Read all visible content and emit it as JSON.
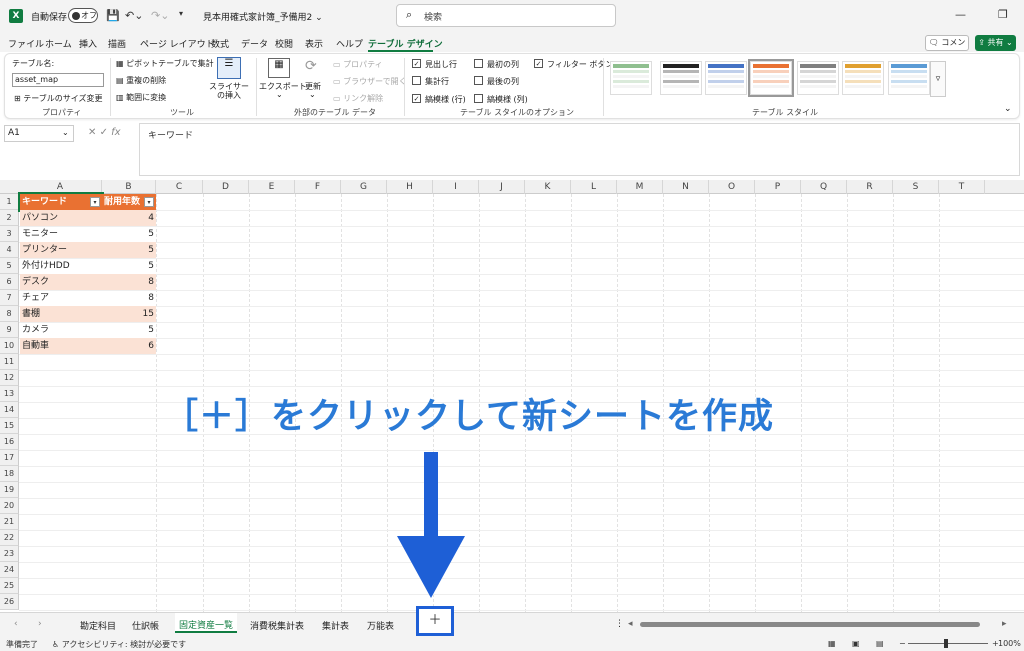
{
  "titlebar": {
    "logo": "X",
    "autosave_label": "自動保存",
    "autosave_state": "オフ",
    "save_icon": "save-icon",
    "undo_icon": "undo-icon",
    "redo_icon": "redo-icon",
    "doc_title": "見本用確式家計簿_予備用2",
    "search_placeholder": "検索",
    "minimize": "—",
    "restore": "❐"
  },
  "menu": {
    "items": [
      "ファイル",
      "ホーム",
      "挿入",
      "描画",
      "ページ レイアウト",
      "数式",
      "データ",
      "校閲",
      "表示",
      "ヘルプ",
      "テーブル デザイン"
    ],
    "comment_label": "コメント",
    "share_label": "共有"
  },
  "ribbon": {
    "properties": {
      "tablename_label": "テーブル名:",
      "tablename_value": "asset_map",
      "resize_label": "テーブルのサイズ変更",
      "group_label": "プロパティ"
    },
    "tools": {
      "pivot": "ピボットテーブルで集計",
      "remove_dup": "重複の削除",
      "convert": "範囲に変換",
      "slicer": "スライサーの挿入",
      "group_label": "ツール"
    },
    "external": {
      "export": "エクスポート",
      "refresh": "更新",
      "properties": "プロパティ",
      "open_browser": "ブラウザーで開く",
      "unlink": "リンク解除",
      "group_label": "外部のテーブル データ"
    },
    "options": {
      "header_row": "見出し行",
      "total_row": "集計行",
      "banded_rows": "縞模様 (行)",
      "first_col": "最初の列",
      "last_col": "最後の列",
      "banded_cols": "縞模様 (列)",
      "filter_btn": "フィルター ボタン",
      "group_label": "テーブル スタイルのオプション"
    },
    "styles": {
      "group_label": "テーブル スタイル",
      "swatch_colors": [
        "#8fbf8f",
        "#222222",
        "#4472c4",
        "#e97132",
        "#808080",
        "#e0a030",
        "#5b9bd5"
      ]
    }
  },
  "formula": {
    "namebox": "A1",
    "cancel": "✕",
    "enter": "✓",
    "fx": "fx",
    "content": "キーワード"
  },
  "grid": {
    "columns": [
      "A",
      "B",
      "C",
      "D",
      "E",
      "F",
      "G",
      "H",
      "I",
      "J",
      "K",
      "L",
      "M",
      "N",
      "O",
      "P",
      "Q",
      "R",
      "S",
      "T"
    ],
    "row_numbers": [
      "1",
      "2",
      "3",
      "4",
      "5",
      "6",
      "7",
      "8",
      "9",
      "10",
      "11",
      "12",
      "13",
      "14",
      "15",
      "16",
      "17",
      "18",
      "19",
      "20",
      "21",
      "22",
      "23",
      "24",
      "25",
      "26"
    ],
    "header": [
      "キーワード",
      "耐用年数"
    ],
    "rows": [
      [
        "パソコン",
        "4"
      ],
      [
        "モニター",
        "5"
      ],
      [
        "プリンター",
        "5"
      ],
      [
        "外付けHDD",
        "5"
      ],
      [
        "デスク",
        "8"
      ],
      [
        "チェア",
        "8"
      ],
      [
        "書棚",
        "15"
      ],
      [
        "カメラ",
        "5"
      ],
      [
        "自動車",
        "6"
      ]
    ]
  },
  "annotation": {
    "text": "［＋］をクリックして新シートを作成",
    "color": "#2a7ad6"
  },
  "sheets": {
    "tabs": [
      "勘定科目",
      "仕訳帳",
      "固定資産一覧",
      "消費税集計表",
      "集計表",
      "万能表"
    ],
    "active": "固定資産一覧",
    "add": "＋",
    "more": "⋮"
  },
  "status": {
    "ready": "準備完了",
    "accessibility": "アクセシビリティ: 検討が必要です",
    "zoom": "100%"
  },
  "colors": {
    "accent": "#107c41",
    "table_header": "#e97132",
    "table_band": "#fbe2d5",
    "highlight": "#1e5fd6"
  }
}
